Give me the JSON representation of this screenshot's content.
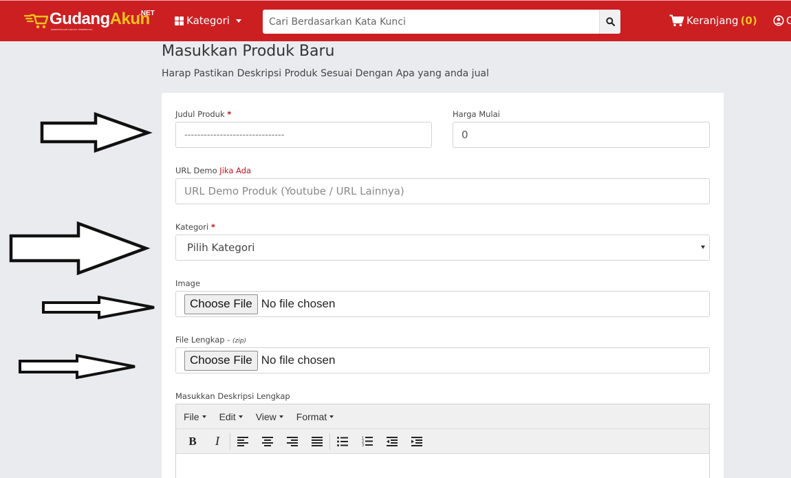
{
  "navbar": {
    "logo_part1": "Gudang",
    "logo_part2": "Akun",
    "logo_suffix": ".NET",
    "logo_tagline": "MARKETPLACE DIGITAL TERPERCAYA",
    "category_menu": "Kategori",
    "search_placeholder": "Cari Berdasarkan Kata Kunci",
    "cart_label": "Keranjang",
    "cart_count": "(0)",
    "user_label": "C",
    "colors": {
      "brand_red": "#cc1f22",
      "accent_yellow": "#f6c21b"
    }
  },
  "page": {
    "title": "Masukkan Produk Baru",
    "subtitle": "Harap Pastikan Deskripsi Produk Sesuai Dengan Apa yang anda jual"
  },
  "form": {
    "judul": {
      "label": "Judul Produk",
      "required_mark": "*",
      "value": "-------------------------------"
    },
    "harga": {
      "label": "Harga Mulai",
      "value": "0"
    },
    "url_demo": {
      "label": "URL Demo",
      "optional_note": "Jika Ada",
      "placeholder": "URL Demo Produk (Youtube / URL Lainnya)"
    },
    "kategori": {
      "label": "Kategori",
      "required_mark": "*",
      "selected": "Pilih Kategori"
    },
    "image": {
      "label": "Image",
      "button": "Choose File",
      "status": "No file chosen"
    },
    "file_lengkap": {
      "label": "File Lengkap - ",
      "note": "(zip)",
      "button": "Choose File",
      "status": "No file chosen"
    },
    "deskripsi": {
      "label": "Masukkan Deskripsi Lengkap",
      "menus": [
        "File",
        "Edit",
        "View",
        "Format"
      ],
      "toolbar": [
        "bold-icon",
        "italic-icon",
        "align-left-icon",
        "align-center-icon",
        "align-right-icon",
        "align-justify-icon",
        "bullet-list-icon",
        "numbered-list-icon",
        "outdent-icon",
        "indent-icon"
      ],
      "bold_glyph": "B",
      "italic_glyph": "I"
    }
  }
}
